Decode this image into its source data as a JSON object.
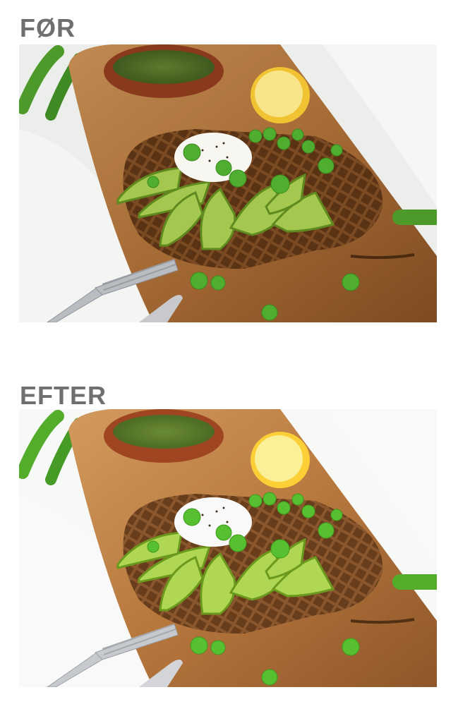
{
  "labels": {
    "before": "FØR",
    "after": "EFTER"
  },
  "photos": [
    {
      "id": "before",
      "subject": "pea-waffle-avocado-on-wooden-board"
    },
    {
      "id": "after",
      "subject": "pea-waffle-avocado-on-wooden-board"
    }
  ],
  "colors": {
    "label_gray": "#6f6f6f",
    "background": "#ffffff",
    "wood": "#a56d3a",
    "pea_green": "#4fae2f",
    "avocado": "#9cc24a",
    "waffle": "#7a4a22"
  }
}
